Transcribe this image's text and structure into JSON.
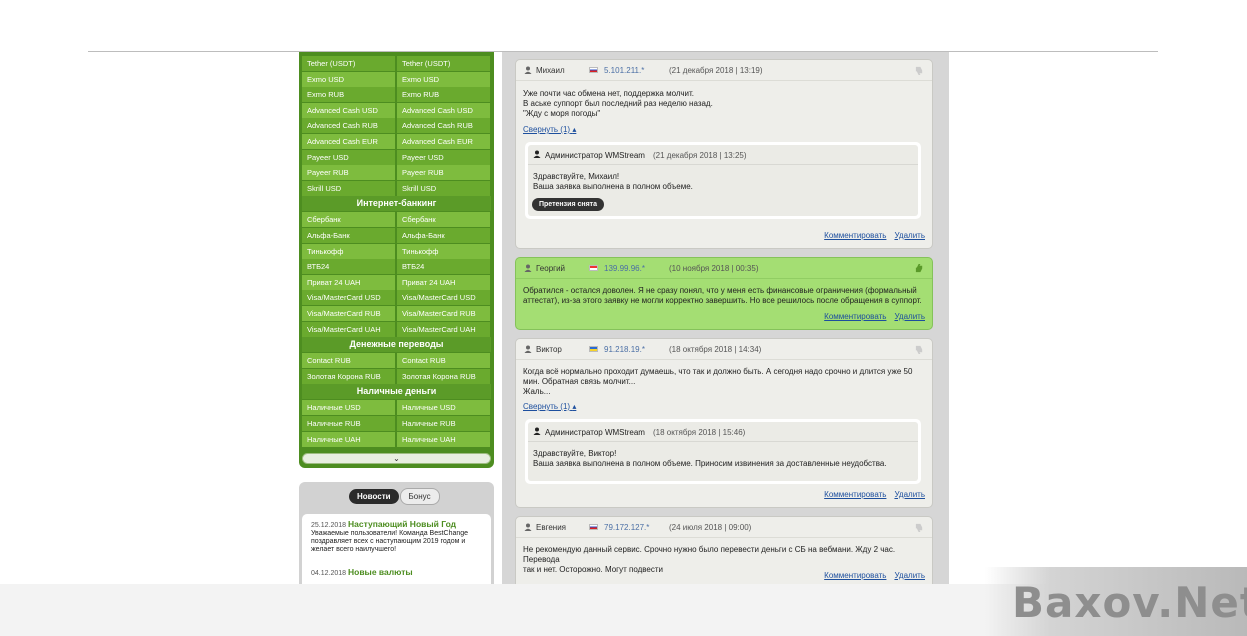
{
  "sidebar": {
    "rows_top": [
      [
        "Tether (USDT)",
        "Tether (USDT)"
      ],
      [
        "Exmo USD",
        "Exmo USD"
      ],
      [
        "Exmo RUB",
        "Exmo RUB"
      ],
      [
        "Advanced Cash USD",
        "Advanced Cash USD"
      ],
      [
        "Advanced Cash RUB",
        "Advanced Cash RUB"
      ],
      [
        "Advanced Cash EUR",
        "Advanced Cash EUR"
      ],
      [
        "Payeer USD",
        "Payeer USD"
      ],
      [
        "Payeer RUB",
        "Payeer RUB"
      ],
      [
        "Skrill USD",
        "Skrill USD"
      ]
    ],
    "cat_bank": "Интернет-банкинг",
    "rows_bank": [
      [
        "Сбербанк",
        "Сбербанк"
      ],
      [
        "Альфа-Банк",
        "Альфа-Банк"
      ],
      [
        "Тинькофф",
        "Тинькофф"
      ],
      [
        "ВТБ24",
        "ВТБ24"
      ],
      [
        "Приват 24 UAH",
        "Приват 24 UAH"
      ],
      [
        "Visa/MasterCard USD",
        "Visa/MasterCard USD"
      ],
      [
        "Visa/MasterCard RUB",
        "Visa/MasterCard RUB"
      ],
      [
        "Visa/MasterCard UAH",
        "Visa/MasterCard UAH"
      ]
    ],
    "cat_transfers": "Денежные переводы",
    "rows_transfers": [
      [
        "Contact RUB",
        "Contact RUB"
      ],
      [
        "Золотая Корона RUB",
        "Золотая Корона RUB"
      ]
    ],
    "cat_cash": "Наличные деньги",
    "rows_cash": [
      [
        "Наличные USD",
        "Наличные USD"
      ],
      [
        "Наличные RUB",
        "Наличные RUB"
      ],
      [
        "Наличные UAH",
        "Наличные UAH"
      ]
    ],
    "scroll_glyph": "⌄"
  },
  "news": {
    "tab_news": "Новости",
    "tab_bonus": "Бонус",
    "items": [
      {
        "date": "25.12.2018",
        "title": "Наступающий Новый Год",
        "text": "Уважаемые пользователи! Команда BestChange поздравляет всех с наступающим 2019 годом и желает всего наилучшего!"
      },
      {
        "date": "04.12.2018",
        "title": "Новые валюты",
        "text": ""
      }
    ]
  },
  "reviews": [
    {
      "name": "Михаил",
      "ip": "5.101.211.*",
      "date": "(21 декабря 2018 | 13:19)",
      "text": "Уже почти час обмена нет, поддержка молчит.\nВ аське суппорт был последний раз неделю назад.\n\"Жду с моря погоды\"",
      "collapse": "Свернуть (1)",
      "reply": {
        "name": "Администратор WMStream",
        "date": "(21 декабря 2018 | 13:25)",
        "text": "Здравствуйте, Михаил!\nВаша заявка выполнена в полном объеме.",
        "badge": "Претензия снята"
      }
    },
    {
      "name": "Георгий",
      "ip": "139.99.96.*",
      "date": "(10 ноября 2018 | 00:35)",
      "text": "Обратился - остался доволен. Я не сразу понял, что у меня есть финансовые ограничения (формальный\nаттестат), из-за этого заявку не могли корректно завершить. Но все решилось после обращения в суппорт."
    },
    {
      "name": "Виктор",
      "ip": "91.218.19.*",
      "date": "(18 октября 2018 | 14:34)",
      "text": "Когда всё нормально проходит думаешь, что так и должно быть. А сегодня надо срочно и длится уже 50\nмин. Обратная связь молчит...\nЖаль...",
      "collapse": "Свернуть (1)",
      "reply": {
        "name": "Администратор WMStream",
        "date": "(18 октября 2018 | 15:46)",
        "text": "Здравствуйте, Виктор!\nВаша заявка выполнена в полном объеме. Приносим извинения за доставленные неудобства."
      }
    },
    {
      "name": "Евгения",
      "ip": "79.172.127.*",
      "date": "(24 июля 2018 | 09:00)",
      "text": "Не рекомендую данный сервис. Срочно нужно было перевести деньги с СБ на вебмани. Жду 2 час. Перевода\nтак и нет. Осторожно. Могут подвести"
    }
  ],
  "actions": {
    "comment": "Комментировать",
    "delete": "Удалить"
  },
  "watermark": "Baxov.Net",
  "colors": {
    "sidebar_green": "#4d8d20",
    "positive_card": "#a4de73",
    "link_blue": "#1d4f9e"
  }
}
